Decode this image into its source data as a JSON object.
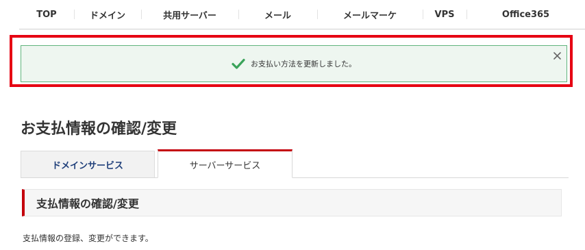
{
  "nav": {
    "items": [
      {
        "label": "TOP"
      },
      {
        "label": "ドメイン"
      },
      {
        "label": "共用サーバー"
      },
      {
        "label": "メール"
      },
      {
        "label": "メールマーケ"
      },
      {
        "label": "VPS"
      },
      {
        "label": "Office365"
      }
    ]
  },
  "notice": {
    "message": "お支払い方法を更新しました。",
    "icon": "check-icon",
    "close_icon": "close-icon",
    "colors": {
      "highlight_border": "#e60012",
      "border": "#5fb47c",
      "background": "#eef6f0",
      "check": "#3aa35a"
    }
  },
  "page": {
    "title": "お支払情報の確認/変更"
  },
  "tabs": [
    {
      "label": "ドメインサービス",
      "active": false
    },
    {
      "label": "サーバーサービス",
      "active": true
    }
  ],
  "section": {
    "title": "支払情報の確認/変更",
    "description": "支払情報の登録、変更ができます。"
  },
  "colors": {
    "accent": "#c4000b"
  }
}
